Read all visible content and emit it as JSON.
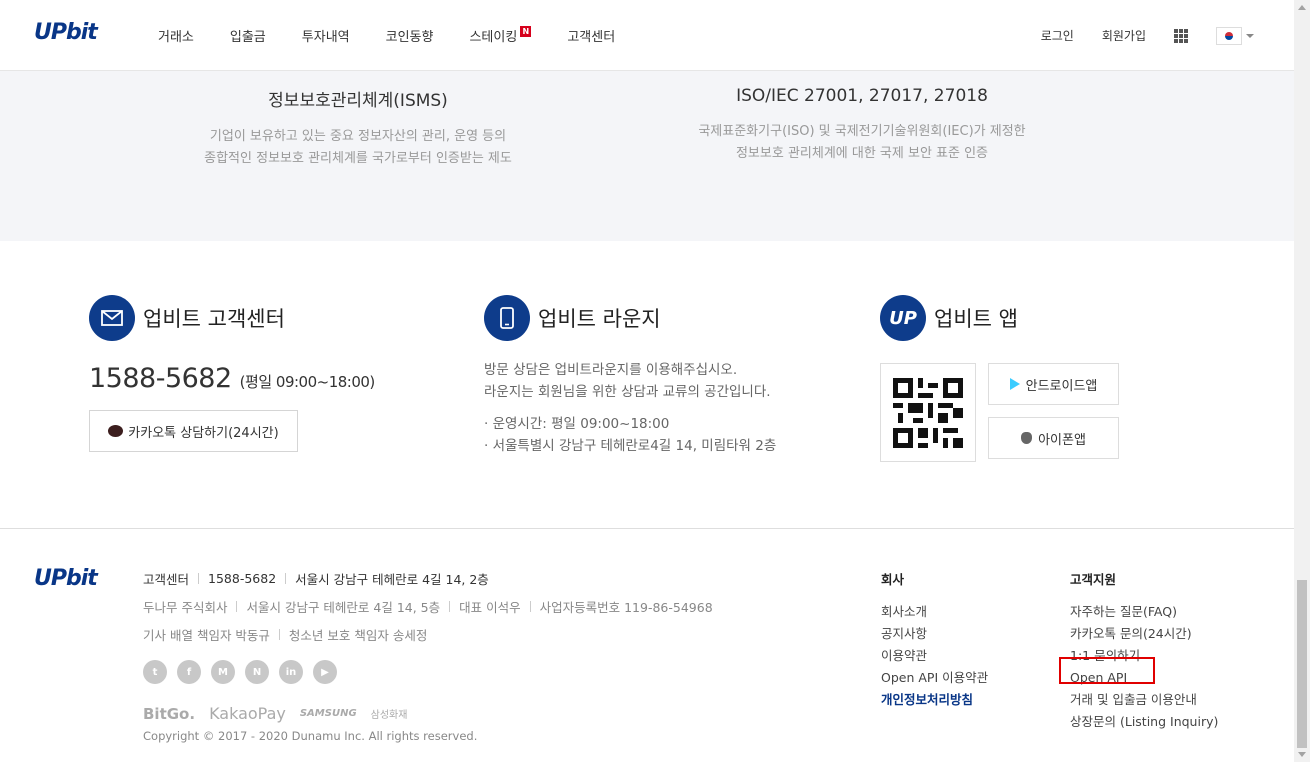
{
  "header": {
    "logo": "UPbit",
    "nav": [
      "거래소",
      "입출금",
      "투자내역",
      "코인동향",
      "스테이킹",
      "고객센터"
    ],
    "new_badge": "N",
    "login": "로그인",
    "signup": "회원가입",
    "language_icon": "korea-flag-icon"
  },
  "certifications": [
    {
      "title": "정보보호관리체계(ISMS)",
      "line1": "기업이 보유하고 있는 중요 정보자산의 관리, 운영 등의",
      "line2": "종합적인 정보보호 관리체계를 국가로부터 인증받는 제도"
    },
    {
      "title": "ISO/IEC 27001, 27017, 27018",
      "line1": "국제표준화기구(ISO) 및 국제전기기술위원회(IEC)가 제정한",
      "line2": "정보보호 관리체계에 대한 국제 보안 표준 인증"
    }
  ],
  "service": {
    "center": {
      "title": "업비트 고객센터",
      "phone": "1588-5682",
      "hours_label": "(평일",
      "hours": "09:00~18:00)",
      "kakao_button": "카카오톡 상담하기(24시간)"
    },
    "lounge": {
      "title": "업비트 라운지",
      "desc1": "방문 상담은 업비트라운지를 이용해주십시오.",
      "desc2": "라운지는 회원님을 위한 상담과 교류의 공간입니다.",
      "items": [
        "운영시간: 평일 09:00~18:00",
        "서울특별시 강남구 테헤란로4길 14, 미림타워 2층"
      ]
    },
    "app": {
      "title": "업비트 앱",
      "icon_text": "UP",
      "android": "안드로이드앱",
      "iphone": "아이폰앱"
    }
  },
  "footer": {
    "logo": "UPbit",
    "row1": [
      "고객센터",
      "1588-5682",
      "서울시 강남구 테헤란로 4길 14, 2층"
    ],
    "row2": [
      "두나무 주식회사",
      "서울시 강남구 테헤란로 4길 14, 5층",
      "대표 이석우",
      "사업자등록번호 119-86-54968"
    ],
    "row3": [
      "기사 배열 책임자 박동규",
      "청소년 보호 책임자 송세정"
    ],
    "sns": [
      {
        "icon": "twitter-icon",
        "glyph": "t"
      },
      {
        "icon": "facebook-icon",
        "glyph": "f"
      },
      {
        "icon": "medium-icon",
        "glyph": "M"
      },
      {
        "icon": "naver-icon",
        "glyph": "N"
      },
      {
        "icon": "linkedin-icon",
        "glyph": "in"
      },
      {
        "icon": "youtube-icon",
        "glyph": "▶"
      }
    ],
    "partners": [
      "BitGo.",
      "KakaoPay",
      "SAMSUNG",
      "삼성화재"
    ],
    "copyright": "Copyright © 2017 - 2020 Dunamu Inc. All rights reserved.",
    "company": {
      "title": "회사",
      "links": [
        "회사소개",
        "공지사항",
        "이용약관",
        "Open API 이용약관",
        "개인정보처리방침"
      ]
    },
    "support": {
      "title": "고객지원",
      "links": [
        "자주하는 질문(FAQ)",
        "카카오톡 문의(24시간)",
        "1:1 문의하기",
        "Open API",
        "거래 및 입출금 이용안내",
        "상장문의 (Listing Inquiry)"
      ]
    }
  },
  "colors": {
    "brand": "#093687",
    "highlight": "#e00000"
  }
}
